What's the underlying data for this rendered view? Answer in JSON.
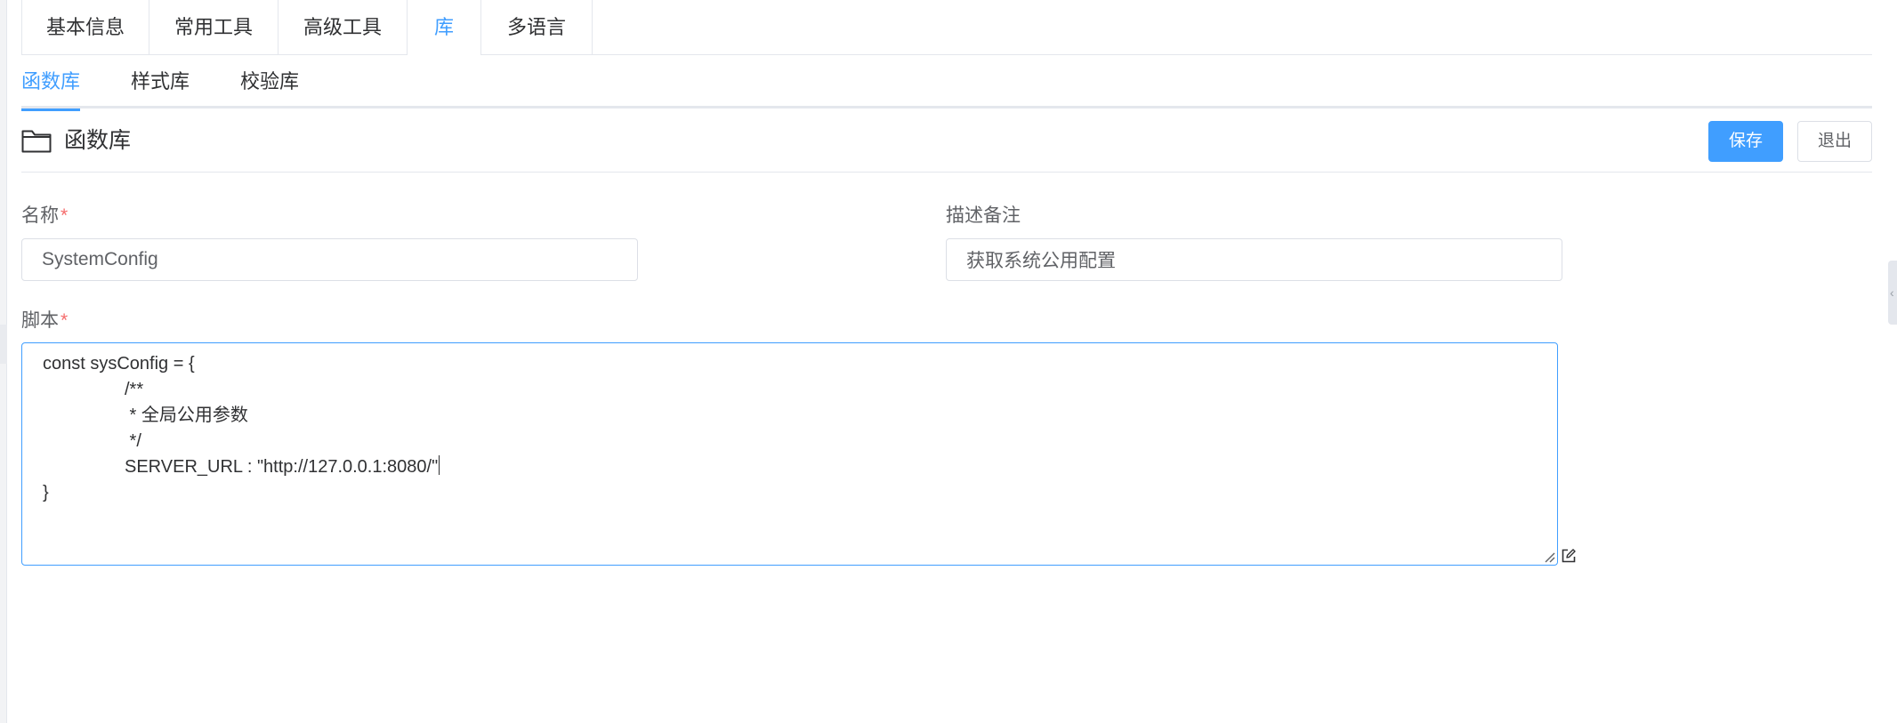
{
  "top_tabs": [
    {
      "label": "基本信息"
    },
    {
      "label": "常用工具"
    },
    {
      "label": "高级工具"
    },
    {
      "label": "库"
    },
    {
      "label": "多语言"
    }
  ],
  "sub_tabs": [
    {
      "label": "函数库"
    },
    {
      "label": "样式库"
    },
    {
      "label": "校验库"
    }
  ],
  "header": {
    "icon": "folder-icon",
    "title": "函数库",
    "save_label": "保存",
    "exit_label": "退出"
  },
  "form": {
    "name_label": "名称",
    "name_required": "*",
    "name_value": "SystemConfig",
    "desc_label": "描述备注",
    "desc_value": "获取系统公用配置",
    "script_label": "脚本",
    "script_required": "*",
    "script_lines": [
      "const sysConfig = {",
      "/**",
      " * 全局公用参数",
      " */",
      "SERVER_URL : \"http://127.0.0.1:8080/\"",
      "}"
    ]
  },
  "colors": {
    "accent": "#409eff",
    "required": "#f56c6c",
    "border": "#dcdfe6"
  }
}
